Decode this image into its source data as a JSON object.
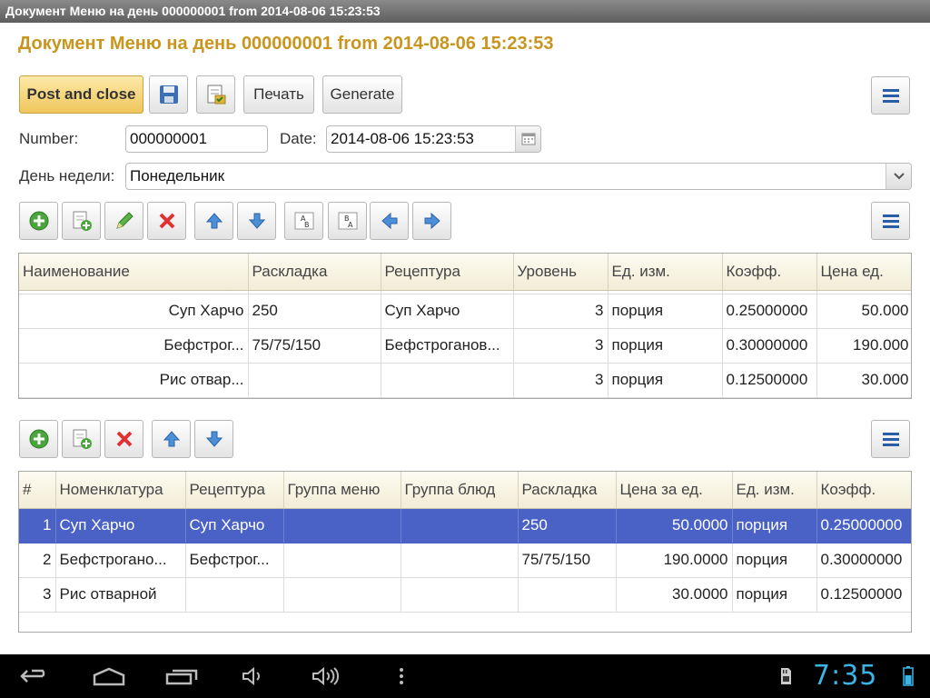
{
  "window": {
    "title": "Документ Меню на день 000000001 from 2014-08-06 15:23:53"
  },
  "header": {
    "title": "Документ Меню на день 000000001 from 2014-08-06 15:23:53"
  },
  "toolbar": {
    "post_and_close": "Post and close",
    "print": "Печать",
    "generate": "Generate"
  },
  "form": {
    "number_label": "Number:",
    "number_value": "000000001",
    "date_label": "Date:",
    "date_value": "2014-08-06 15:23:53",
    "weekday_label": "День недели:",
    "weekday_value": "Понедельник"
  },
  "upper_grid": {
    "columns": [
      "Наименование",
      "Раскладка",
      "Рецептура",
      "Уровень",
      "Ед. изм.",
      "Коэфф.",
      "Цена ед."
    ],
    "rows": [
      [
        "Суп Харчо",
        "250",
        "Суп Харчо",
        "3",
        "порция",
        "0.25000000",
        "50.000"
      ],
      [
        "Бефстрог...",
        "75/75/150",
        "Бефстроганов...",
        "3",
        "порция",
        "0.30000000",
        "190.000"
      ],
      [
        "Рис отвар...",
        "",
        "",
        "3",
        "порция",
        "0.12500000",
        "30.000"
      ]
    ]
  },
  "lower_grid": {
    "columns": [
      "#",
      "Номенклатура",
      "Рецептура",
      "Группа меню",
      "Группа блюд",
      "Раскладка",
      "Цена за ед.",
      "Ед. изм.",
      "Коэфф."
    ],
    "rows": [
      [
        "1",
        "Суп Харчо",
        "Суп Харчо",
        "",
        "",
        "250",
        "50.0000",
        "порция",
        "0.25000000"
      ],
      [
        "2",
        "Бефстрогано...",
        "Бефстрог...",
        "",
        "",
        "75/75/150",
        "190.0000",
        "порция",
        "0.30000000"
      ],
      [
        "3",
        "Рис отварной",
        "",
        "",
        "",
        "",
        "30.0000",
        "порция",
        "0.12500000"
      ]
    ],
    "selected_row": 0
  },
  "system_bar": {
    "time": "7:35"
  },
  "colors": {
    "title": "#c8961e",
    "selection": "#4a62c6",
    "primary_button": "#efc65b",
    "clock": "#3ab4e5"
  }
}
